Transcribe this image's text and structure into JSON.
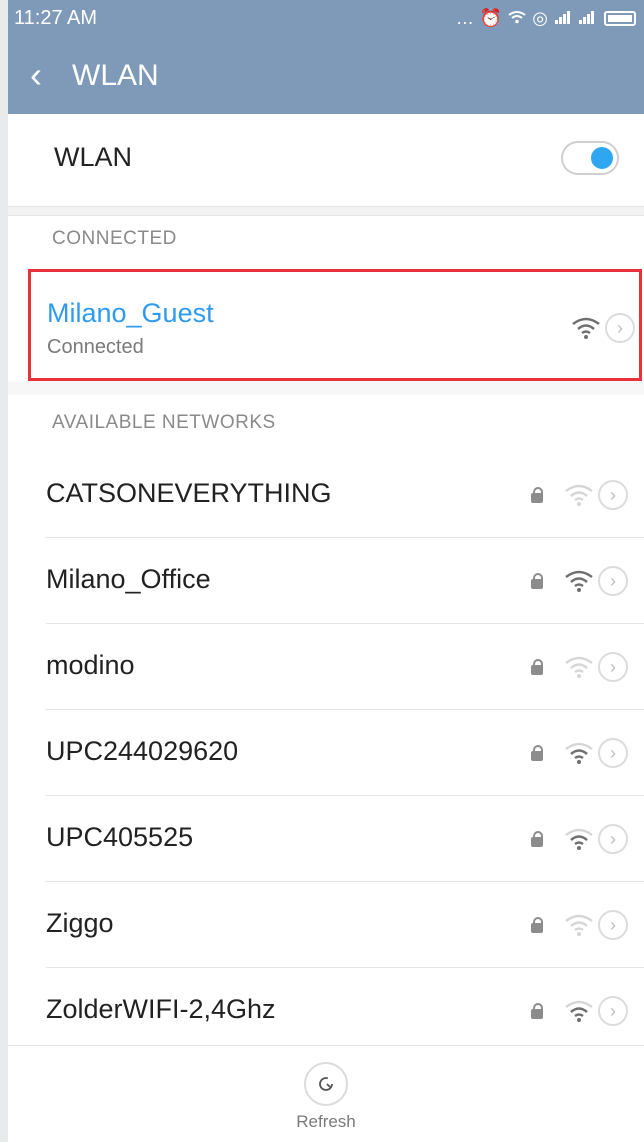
{
  "status_bar": {
    "time": "11:27 AM",
    "icons": [
      "more-icon",
      "alarm-icon",
      "wifi-icon",
      "sync-icon",
      "signal-icon",
      "signal-icon",
      "battery-icon"
    ]
  },
  "header": {
    "title": "WLAN",
    "back_icon": "chevron-left-icon"
  },
  "wlan_toggle": {
    "label": "WLAN",
    "state": "on",
    "accent": "#2fa7f0"
  },
  "sections": {
    "connected_header": "CONNECTED",
    "available_header": "AVAILABLE NETWORKS"
  },
  "connected_network": {
    "name": "Milano_Guest",
    "status": "Connected",
    "name_color": "#2e9bef",
    "highlight_color": "#e8323a"
  },
  "available_networks": [
    {
      "name": "CATSONEVERYTHING",
      "locked": true,
      "signal": "weak"
    },
    {
      "name": "Milano_Office",
      "locked": true,
      "signal": "strong"
    },
    {
      "name": "modino",
      "locked": true,
      "signal": "weak"
    },
    {
      "name": "UPC244029620",
      "locked": true,
      "signal": "medium"
    },
    {
      "name": "UPC405525",
      "locked": true,
      "signal": "medium"
    },
    {
      "name": "Ziggo",
      "locked": true,
      "signal": "weak"
    },
    {
      "name": "ZolderWIFI-2,4Ghz",
      "locked": true,
      "signal": "medium"
    }
  ],
  "bottom": {
    "refresh_label": "Refresh"
  },
  "colors": {
    "header_bg": "#7f9ab9",
    "text": "#222222",
    "muted": "#8a8a8a"
  }
}
